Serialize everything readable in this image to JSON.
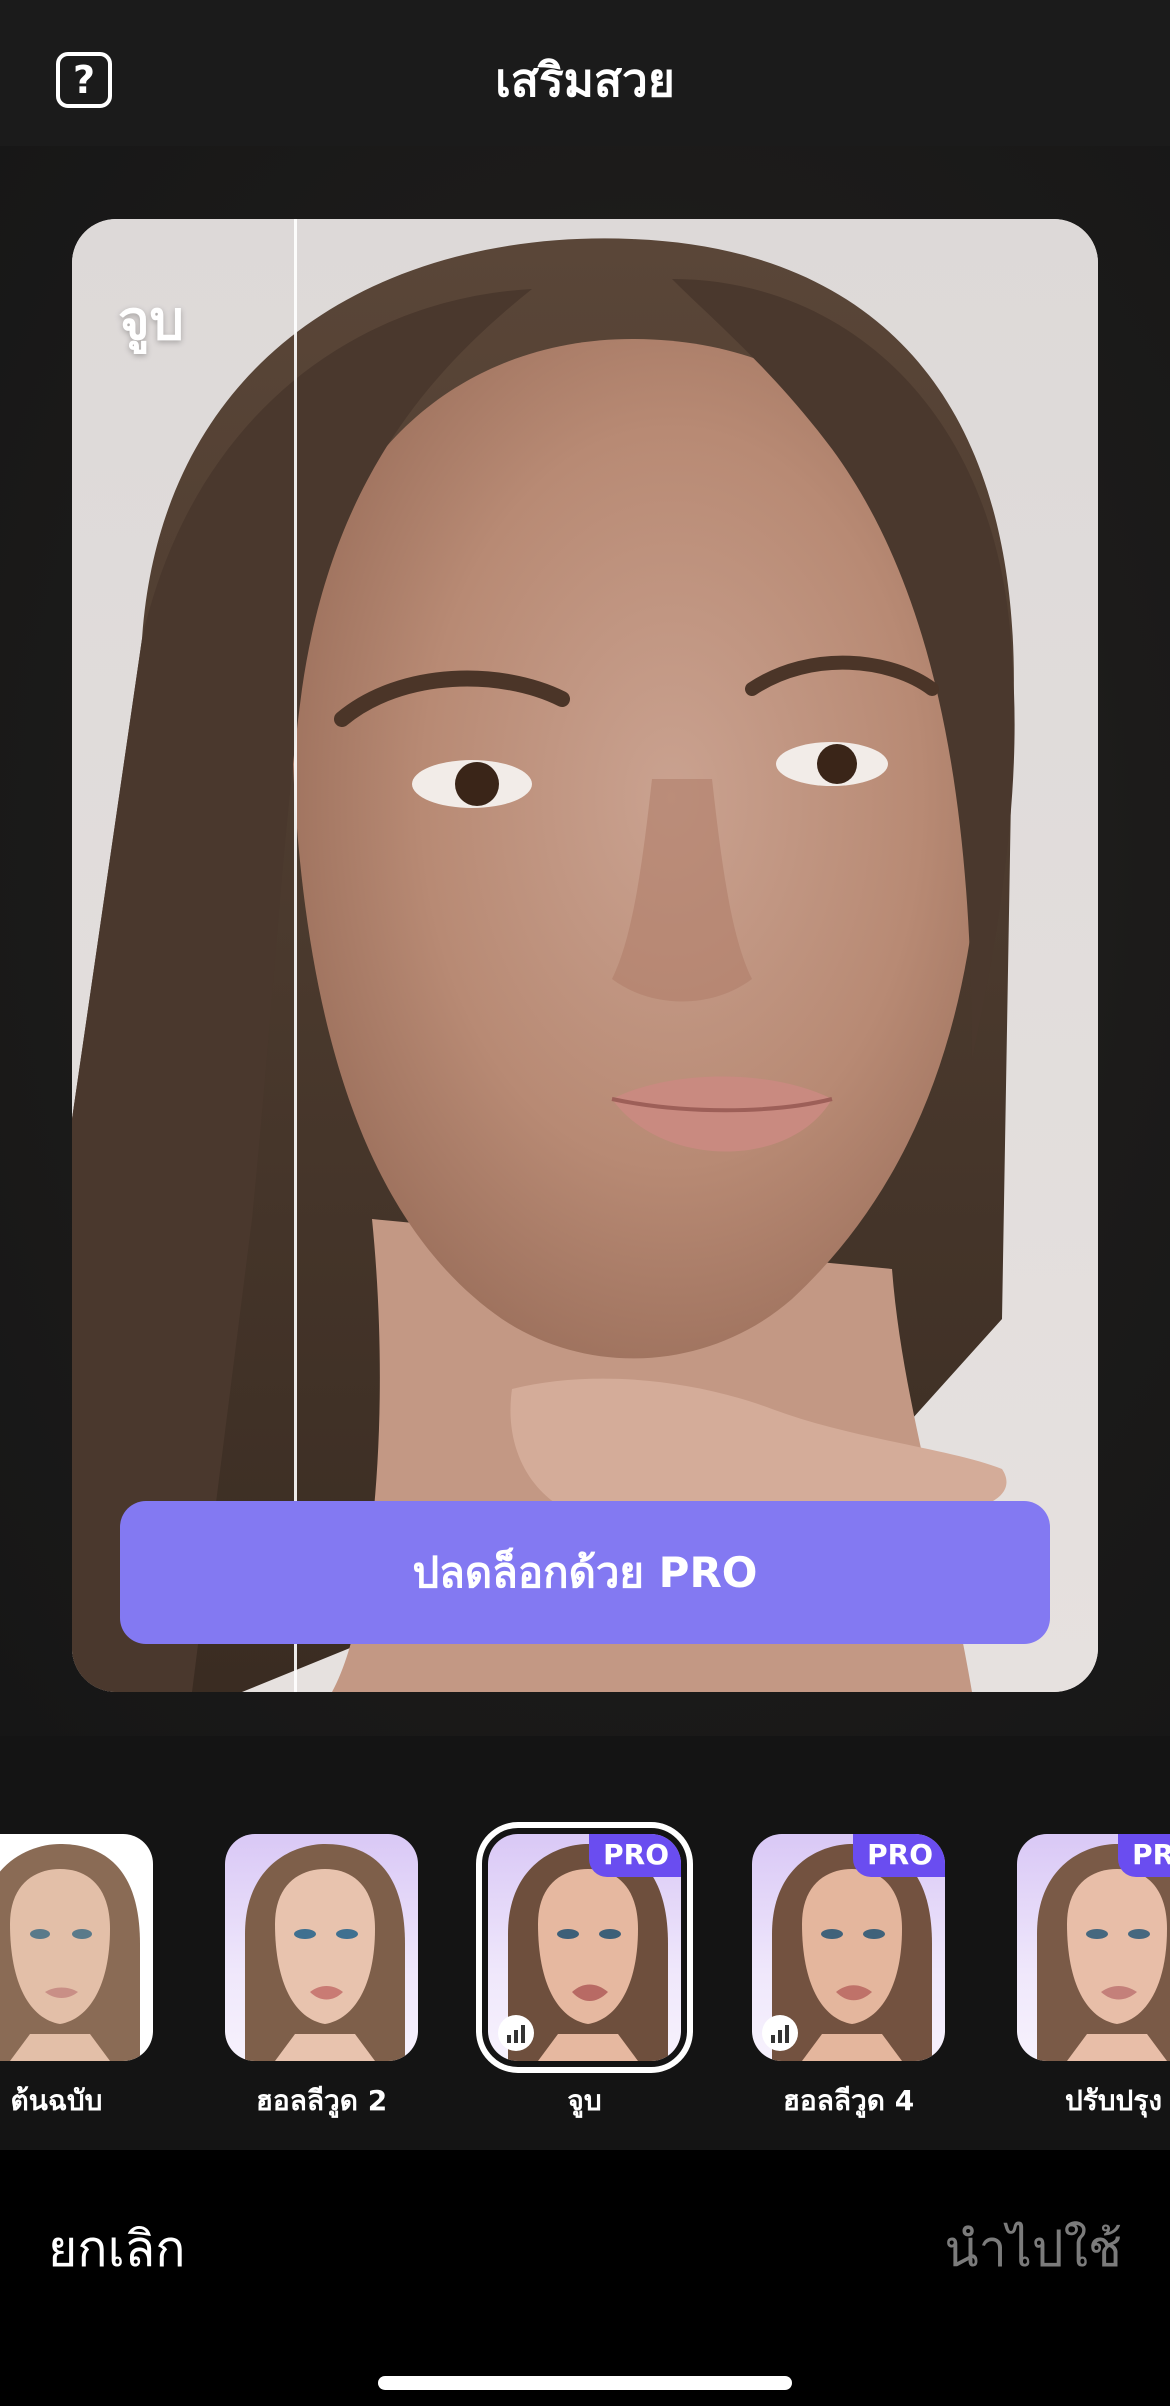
{
  "header": {
    "title": "เสริมสวย",
    "help_icon_glyph": "?"
  },
  "preview": {
    "current_preset_label": "จูบ",
    "unlock_button_label": "ปลดล็อกด้วย PRO"
  },
  "presets": [
    {
      "name": "ต้นฉบับ",
      "pro": false,
      "selected": false
    },
    {
      "name": "ฮอลลีวูด 2",
      "pro": false,
      "selected": false
    },
    {
      "name": "จูบ",
      "pro": true,
      "pro_label": "PRO",
      "selected": true
    },
    {
      "name": "ฮอลลีวูด 4",
      "pro": true,
      "pro_label": "PRO",
      "selected": false
    },
    {
      "name": "ปรับปรุง",
      "pro": true,
      "pro_label": "PRO",
      "selected": false
    }
  ],
  "bottom_bar": {
    "cancel_label": "ยกเลิก",
    "apply_label": "นำไปใช้"
  },
  "colors": {
    "accent_button": "#8379f2",
    "pro_badge": "#6a4df0",
    "apply_disabled_text": "#7b7b7b"
  }
}
